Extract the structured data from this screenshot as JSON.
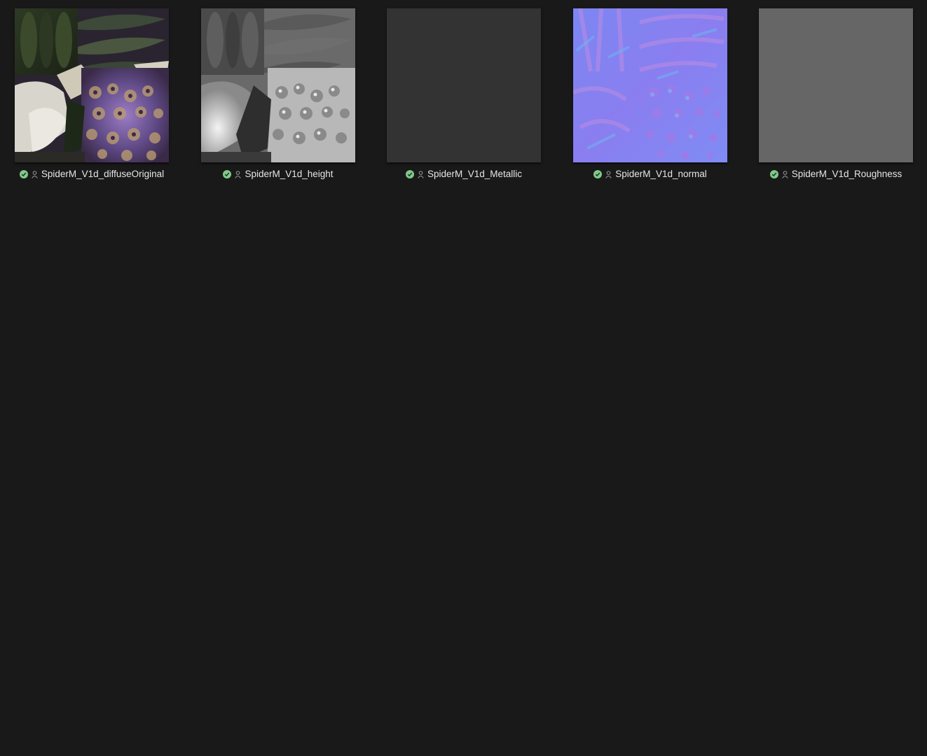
{
  "colors": {
    "background": "#191919",
    "status_ok": "#7fc98a",
    "label_text": "#e6e6e6"
  },
  "files": [
    {
      "name": "SpiderM_V1d_diffuseOriginal",
      "status_icon": "check-circle-icon",
      "owner_icon": "user-icon"
    },
    {
      "name": "SpiderM_V1d_height",
      "status_icon": "check-circle-icon",
      "owner_icon": "user-icon"
    },
    {
      "name": "SpiderM_V1d_Metallic",
      "status_icon": "check-circle-icon",
      "owner_icon": "user-icon"
    },
    {
      "name": "SpiderM_V1d_normal",
      "status_icon": "check-circle-icon",
      "owner_icon": "user-icon"
    },
    {
      "name": "SpiderM_V1d_Roughness",
      "status_icon": "check-circle-icon",
      "owner_icon": "user-icon"
    }
  ]
}
